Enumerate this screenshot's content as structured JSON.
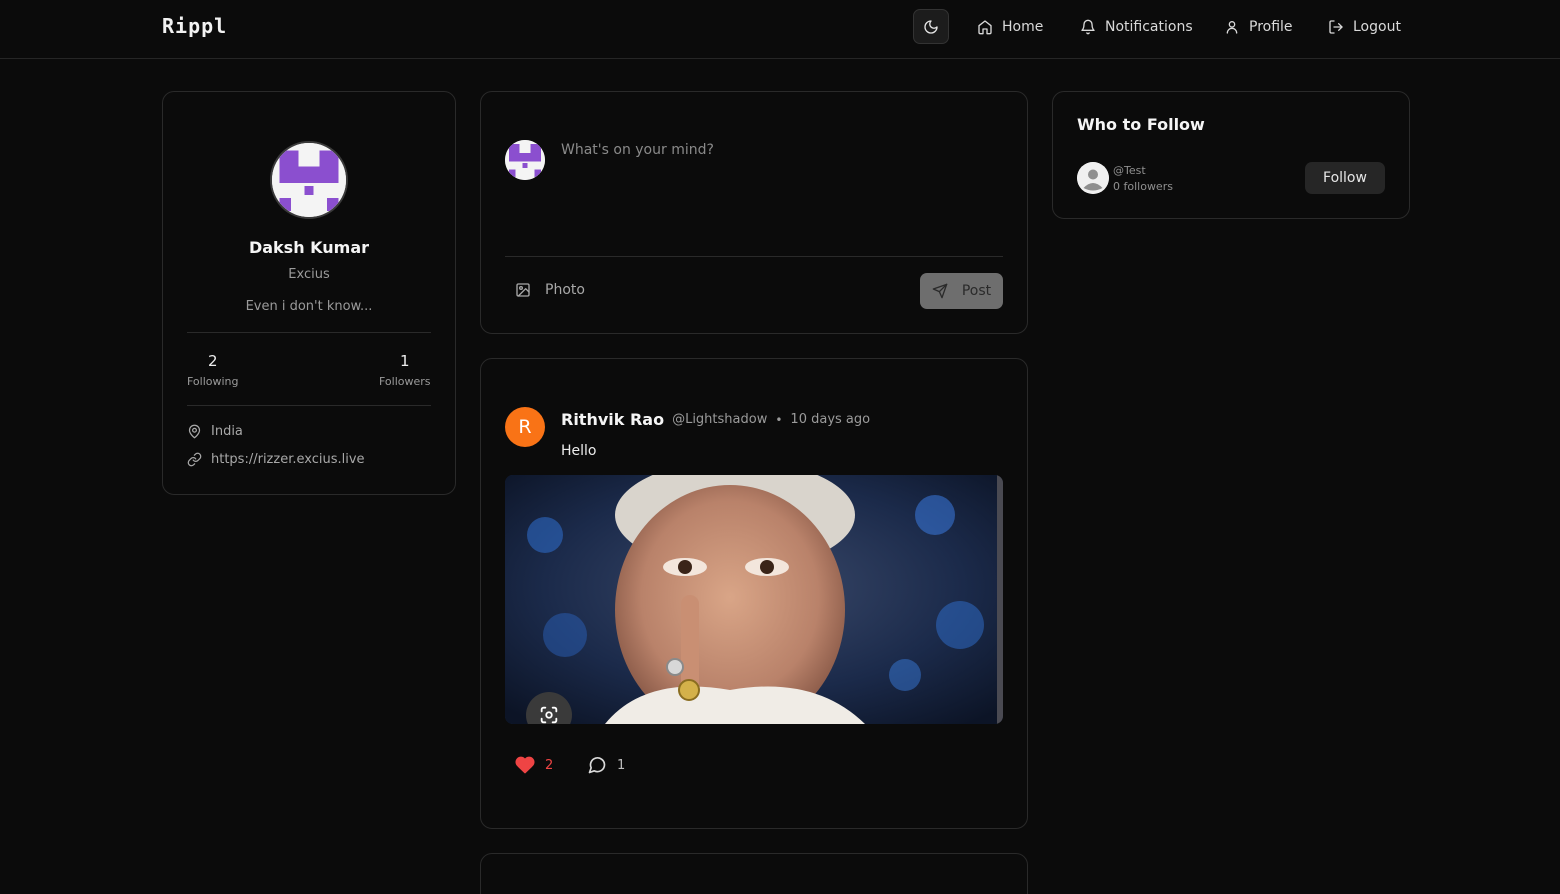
{
  "app": {
    "brand": "Rippl"
  },
  "nav": {
    "theme_icon": "moon-icon",
    "items": [
      {
        "label": "Home",
        "icon": "home-icon"
      },
      {
        "label": "Notifications",
        "icon": "bell-icon"
      },
      {
        "label": "Profile",
        "icon": "user-icon"
      },
      {
        "label": "Logout",
        "icon": "logout-icon"
      }
    ]
  },
  "profile": {
    "name": "Daksh Kumar",
    "handle": "Excius",
    "bio": "Even i don't know...",
    "following_count": "2",
    "following_label": "Following",
    "followers_count": "1",
    "followers_label": "Followers",
    "location": "India",
    "website": "https://rizzer.excius.live"
  },
  "composer": {
    "placeholder": "What's on your mind?",
    "photo_label": "Photo",
    "post_label": "Post"
  },
  "posts": [
    {
      "avatar_initial": "R",
      "author": "Rithvik Rao",
      "username": "@Lightshadow",
      "separator": "•",
      "time": "10 days ago",
      "text": "Hello",
      "likes": "2",
      "comments": "1"
    }
  ],
  "who_to_follow": {
    "title": "Who to Follow",
    "users": [
      {
        "handle": "@Test",
        "followers": "0 followers",
        "button": "Follow"
      }
    ]
  },
  "colors": {
    "background": "#0b0b0b",
    "border": "#2a2a2a",
    "like": "#ef4444",
    "avatar_orange": "#f97316",
    "identicon": "#8b4fcf"
  }
}
